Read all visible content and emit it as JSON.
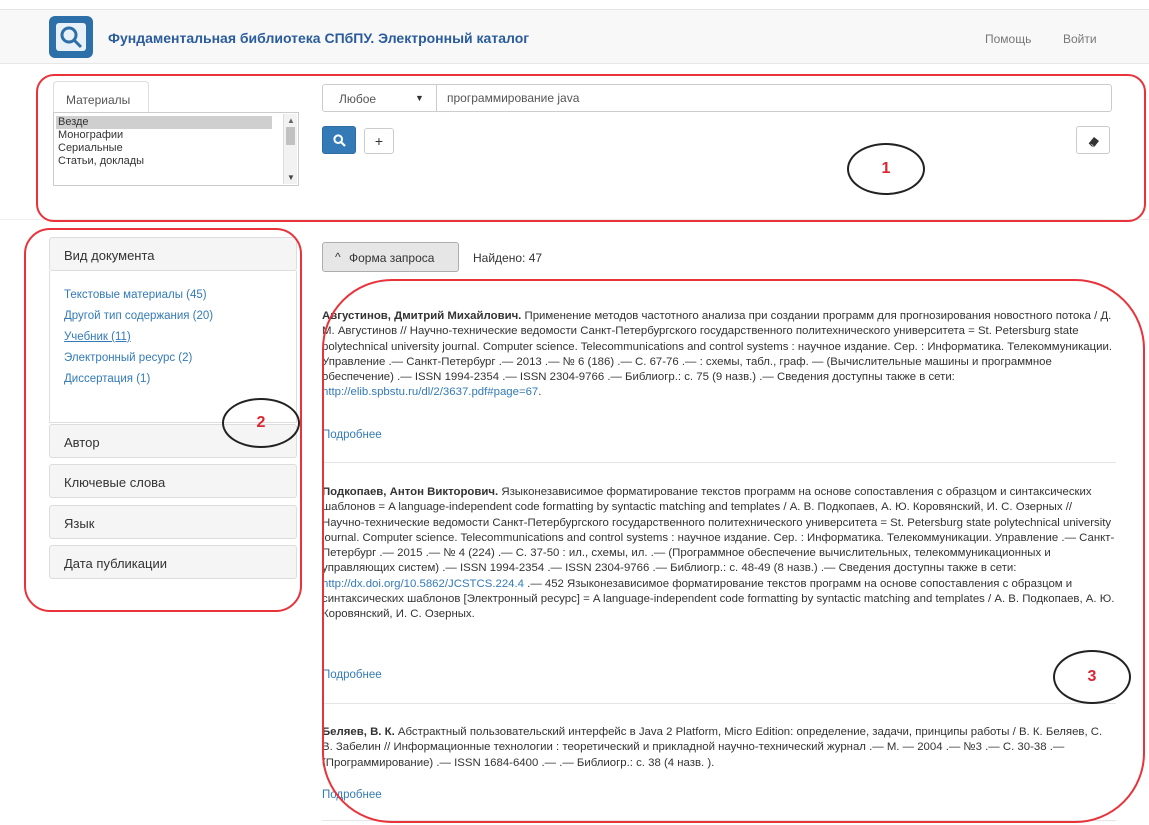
{
  "navbar": {
    "brand": "Фундаментальная библиотека СПбПУ. Электронный каталог",
    "help": "Помощь",
    "login": "Войти"
  },
  "search": {
    "materials_tab": "Материалы",
    "materials": [
      "Везде",
      "Монографии",
      "Сериальные",
      "Статьи, доклады"
    ],
    "field_select": "Любое",
    "query": "программирование java",
    "plus": "+"
  },
  "facets": {
    "doc_type": {
      "title": "Вид документа",
      "items": [
        "Текстовые материалы (45)",
        "Другой тип содержания (20)",
        "Учебник (11)",
        "Электронный ресурс (2)",
        "Диссертация (1)"
      ]
    },
    "author": "Автор",
    "keywords": "Ключевые слова",
    "language": "Язык",
    "pub_date": "Дата публикации"
  },
  "results": {
    "query_form_button": "Форма запроса",
    "found": "Найдено: 47",
    "more_label": "Подробнее",
    "records": [
      {
        "author": "Августинов, Дмитрий Михайлович.",
        "text": " Применение методов частотного анализа при создании программ для прогнозирования новостного потока / Д. М. Августинов // Научно-технические ведомости Санкт-Петербургского государственного политехнического университета = St. Petersburg state polytechnical university journal. Computer science. Telecommunications and control systems : научное издание. Сер. : Информатика. Телекоммуникации. Управление .— Санкт-Петербург .— 2013 .— № 6 (186) .— С. 67-76 .— : схемы, табл., граф. — (Вычислительные машины и программное обеспечение) .— ISSN 1994-2354 .— ISSN 2304-9766 .— Библиогр.: с. 75 (9 назв.) .— Сведения доступны также в сети: ",
        "link": "http://elib.spbstu.ru/dl/2/3637.pdf#page=67",
        "tail": "."
      },
      {
        "author": "Подкопаев, Антон Викторович.",
        "text": " Языконезависимое форматирование текстов программ на основе сопоставления с образцом и синтаксических шаблонов = A language-independent code formatting by syntactic matching and templates / А. В. Подкопаев, А. Ю. Коровянский, И. С. Озерных // Научно-технические ведомости Санкт-Петербургского государственного политехнического университета = St. Petersburg state polytechnical university journal. Computer science. Telecommunications and control systems : научное издание. Сер. : Информатика. Телекоммуникации. Управление .— Санкт-Петербург .— 2015 .— № 4 (224) .— С. 37-50 : ил., схемы, ил. .— (Программное обеспечение вычислительных, телекоммуникационных и управляющих систем) .— ISSN 1994-2354 .— ISSN 2304-9766 .— Библиогр.: с. 48-49 (8 назв.) .— Сведения доступны также в сети: ",
        "link": "http://dx.doi.org/10.5862/JCSTCS.224.4",
        "tail": " .— 452 Языконезависимое форматирование текстов программ на основе сопоставления с образцом и синтаксических шаблонов [Электронный ресурс] = A language-independent code formatting by syntactic matching and templates / А. В. Подкопаев, А. Ю. Коровянский, И. С. Озерных."
      },
      {
        "author": "Беляев, В. К.",
        "text": " Абстрактный пользовательский интерфейс в Java 2 Platform, Micro Edition: определение, задачи, принципы работы / В. К. Беляев, С. В. Забелин // Информационные технологии : теоретический и прикладной научно-технический журнал .— М. — 2004 .— №3 .— С. 30-38 .— (Программирование) .— ISSN 1684-6400 .— .— Библиогр.: с. 38 (4 назв. ).",
        "link": "",
        "tail": ""
      }
    ]
  },
  "annotations": {
    "one": "1",
    "two": "2",
    "three": "3"
  },
  "colors": {
    "brand": "#2a5c9c",
    "primary": "#337ab7",
    "annotation": "#e8333b"
  }
}
